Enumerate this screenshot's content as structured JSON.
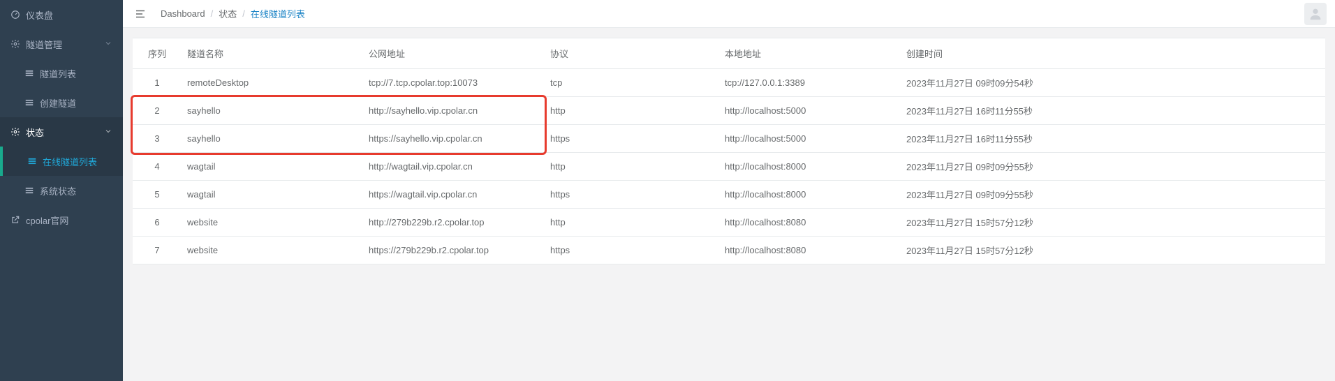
{
  "sidebar": {
    "items": [
      {
        "icon": "dashboard-icon",
        "label": "仪表盘",
        "level": 1
      },
      {
        "icon": "gear-icon",
        "label": "隧道管理",
        "level": 1,
        "expandable": true
      },
      {
        "icon": "grid-icon",
        "label": "隧道列表",
        "level": 2
      },
      {
        "icon": "grid-icon",
        "label": "创建隧道",
        "level": 2
      },
      {
        "icon": "gear-icon",
        "label": "状态",
        "level": 1,
        "expandable": true,
        "activeGroup": true
      },
      {
        "icon": "grid-icon",
        "label": "在线隧道列表",
        "level": 2,
        "active": true
      },
      {
        "icon": "grid-icon",
        "label": "系统状态",
        "level": 2
      },
      {
        "icon": "external-icon",
        "label": "cpolar官网",
        "level": 1,
        "ext": true
      }
    ]
  },
  "breadcrumb": {
    "items": [
      "Dashboard",
      "状态",
      "在线隧道列表"
    ]
  },
  "table": {
    "headers": [
      "序列",
      "隧道名称",
      "公网地址",
      "协议",
      "本地地址",
      "创建时间"
    ],
    "rows": [
      {
        "seq": "1",
        "name": "remoteDesktop",
        "pub": "tcp://7.tcp.cpolar.top:10073",
        "proto": "tcp",
        "local": "tcp://127.0.0.1:3389",
        "time": "2023年11月27日 09时09分54秒"
      },
      {
        "seq": "2",
        "name": "sayhello",
        "pub": "http://sayhello.vip.cpolar.cn",
        "proto": "http",
        "local": "http://localhost:5000",
        "time": "2023年11月27日 16时11分55秒",
        "hl": true
      },
      {
        "seq": "3",
        "name": "sayhello",
        "pub": "https://sayhello.vip.cpolar.cn",
        "proto": "https",
        "local": "http://localhost:5000",
        "time": "2023年11月27日 16时11分55秒",
        "hl": true
      },
      {
        "seq": "4",
        "name": "wagtail",
        "pub": "http://wagtail.vip.cpolar.cn",
        "proto": "http",
        "local": "http://localhost:8000",
        "time": "2023年11月27日 09时09分55秒"
      },
      {
        "seq": "5",
        "name": "wagtail",
        "pub": "https://wagtail.vip.cpolar.cn",
        "proto": "https",
        "local": "http://localhost:8000",
        "time": "2023年11月27日 09时09分55秒"
      },
      {
        "seq": "6",
        "name": "website",
        "pub": "http://279b229b.r2.cpolar.top",
        "proto": "http",
        "local": "http://localhost:8080",
        "time": "2023年11月27日 15时57分12秒"
      },
      {
        "seq": "7",
        "name": "website",
        "pub": "https://279b229b.r2.cpolar.top",
        "proto": "https",
        "local": "http://localhost:8080",
        "time": "2023年11月27日 15时57分12秒"
      }
    ]
  }
}
